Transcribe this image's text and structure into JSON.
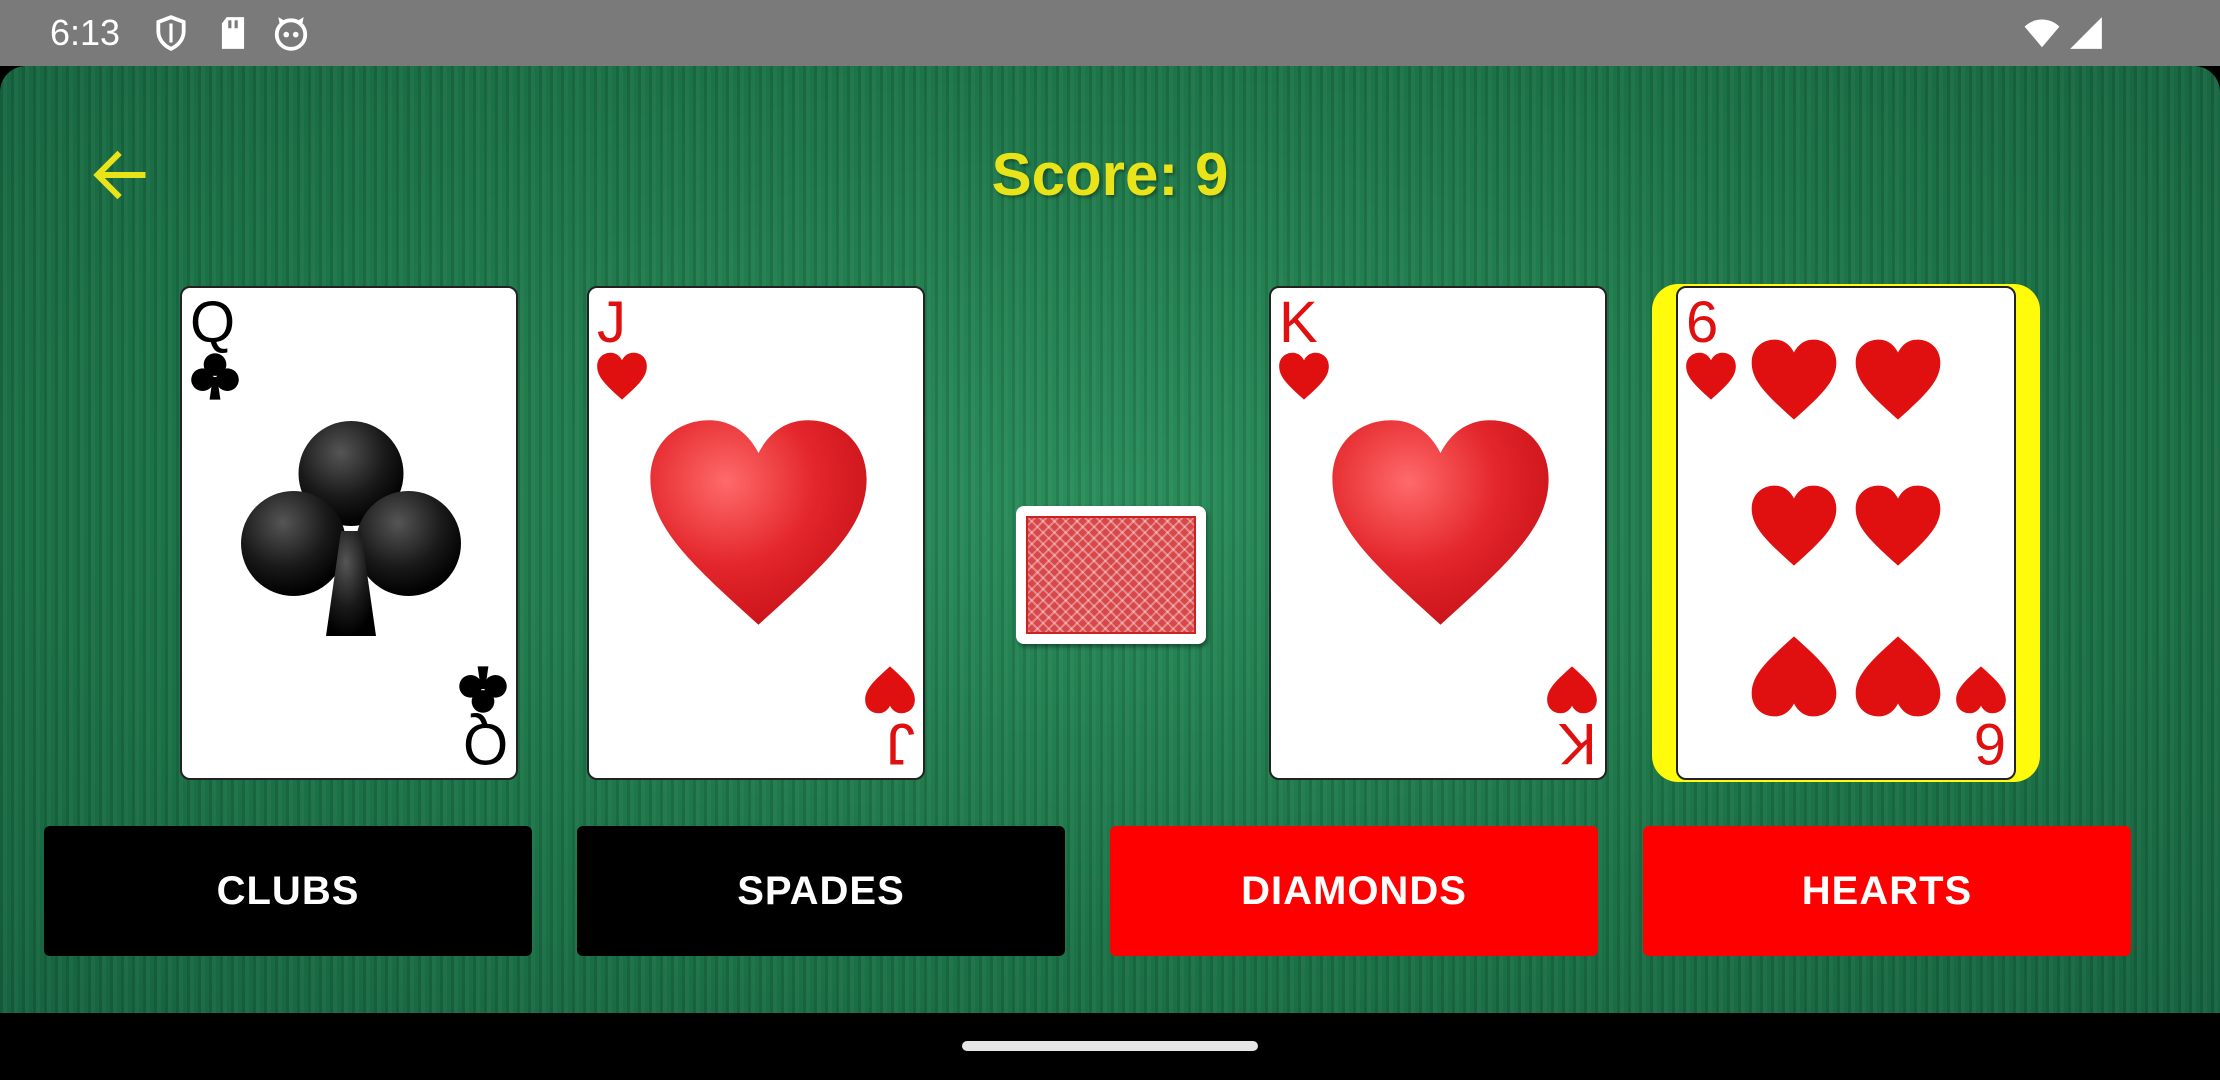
{
  "status_bar": {
    "time": "6:13",
    "icons": [
      "shield-icon",
      "sd-card-icon",
      "cat-face-icon",
      "wifi-icon",
      "signal-icon"
    ]
  },
  "header": {
    "back_icon": "arrow-left-icon",
    "score_text": "Score: 9"
  },
  "cards": [
    {
      "rank": "Q",
      "suit": "clubs",
      "color": "#000000"
    },
    {
      "rank": "J",
      "suit": "hearts",
      "color": "#e01010"
    },
    {
      "rank": "K",
      "suit": "hearts",
      "color": "#e01010"
    },
    {
      "rank": "6",
      "suit": "hearts",
      "color": "#e01010",
      "selected": true
    }
  ],
  "deck": {
    "icon": "card-back-icon"
  },
  "buttons": {
    "clubs": "CLUBS",
    "spades": "SPADES",
    "diamonds": "DIAMONDS",
    "hearts": "HEARTS"
  },
  "colors": {
    "felt": "#1f7a4c",
    "score": "#e9e41a",
    "black_button": "#000000",
    "red_button": "#ff0000",
    "selection": "#fffb0a"
  }
}
